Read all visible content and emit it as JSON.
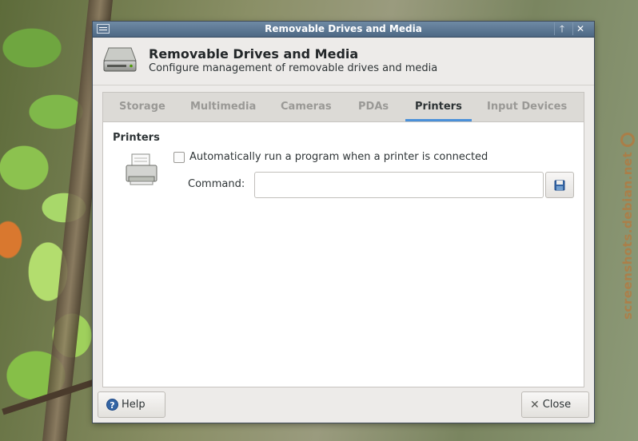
{
  "window": {
    "title": "Removable Drives and Media",
    "maximize_glyph": "🡑",
    "close_glyph": "✕"
  },
  "header": {
    "title": "Removable Drives and Media",
    "subtitle": "Configure management of removable drives and media",
    "icon": "drive-icon"
  },
  "tabs": [
    {
      "label": "Storage",
      "active": false
    },
    {
      "label": "Multimedia",
      "active": false
    },
    {
      "label": "Cameras",
      "active": false
    },
    {
      "label": "PDAs",
      "active": false
    },
    {
      "label": "Printers",
      "active": true
    },
    {
      "label": "Input Devices",
      "active": false
    }
  ],
  "printers": {
    "section_label": "Printers",
    "auto_run_label": "Automatically run a program when a printer is connected",
    "auto_run_checked": false,
    "command_label": "Command:",
    "command_value": "",
    "icon": "printer-icon"
  },
  "buttons": {
    "help": "Help",
    "close": "Close"
  },
  "watermark": "screenshots.debian.net",
  "colors": {
    "titlebar": "#5d7793",
    "accent": "#4a90d9",
    "window_bg": "#edebe9"
  }
}
